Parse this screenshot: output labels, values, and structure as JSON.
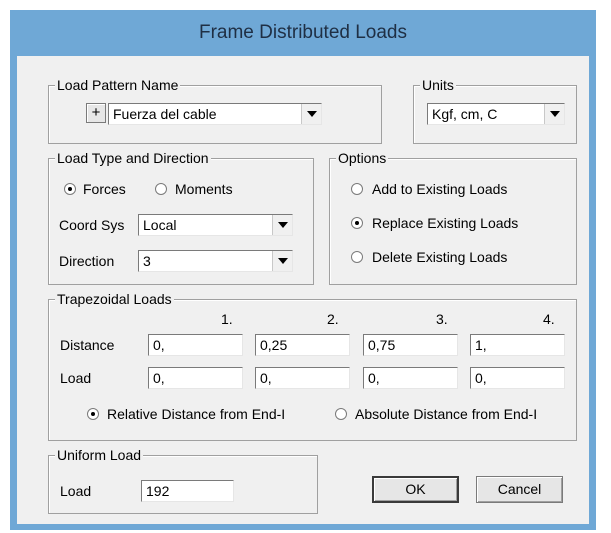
{
  "window": {
    "title": "Frame Distributed Loads"
  },
  "load_pattern": {
    "legend": "Load Pattern Name",
    "plus_label": "+",
    "value": "Fuerza del cable"
  },
  "units": {
    "legend": "Units",
    "value": "Kgf, cm, C"
  },
  "load_type": {
    "legend": "Load Type and Direction",
    "forces_label": "Forces",
    "moments_label": "Moments",
    "selected": "Forces",
    "coord_sys_label": "Coord Sys",
    "coord_sys_value": "Local",
    "direction_label": "Direction",
    "direction_value": "3"
  },
  "options": {
    "legend": "Options",
    "add_label": "Add to Existing Loads",
    "replace_label": "Replace Existing Loads",
    "delete_label": "Delete Existing Loads",
    "selected": "Replace Existing Loads"
  },
  "trapezoidal": {
    "legend": "Trapezoidal Loads",
    "col_headers": [
      "1.",
      "2.",
      "3.",
      "4."
    ],
    "distance_label": "Distance",
    "distances": [
      "0,",
      "0,25",
      "0,75",
      "1,"
    ],
    "load_label": "Load",
    "loads": [
      "0,",
      "0,",
      "0,",
      "0,"
    ],
    "relative_label": "Relative Distance from End-I",
    "absolute_label": "Absolute Distance from End-I",
    "selected": "Relative Distance from End-I"
  },
  "uniform": {
    "legend": "Uniform Load",
    "load_label": "Load",
    "load_value": "192"
  },
  "buttons": {
    "ok": "OK",
    "cancel": "Cancel"
  }
}
